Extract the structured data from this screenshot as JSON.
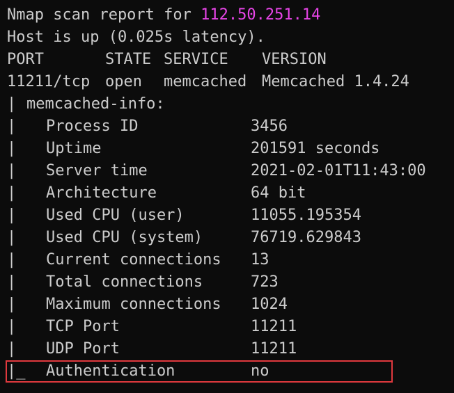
{
  "report": {
    "prefix": "Nmap scan report for ",
    "ip": "112.50.251.14",
    "host_status": "Host is up (0.025s latency).",
    "header": {
      "port": "PORT",
      "state": "STATE",
      "service": "SERVICE",
      "version": "VERSION"
    },
    "service_row": {
      "port": "11211/tcp",
      "state": "open",
      "service": "memcached",
      "version": "Memcached 1.4.24"
    },
    "script_name": "memcached-info:",
    "pipe": "|",
    "last_pipe": "|_",
    "info": [
      {
        "key": "Process ID",
        "value": "3456"
      },
      {
        "key": "Uptime",
        "value": "201591 seconds"
      },
      {
        "key": "Server time",
        "value": "2021-02-01T11:43:00"
      },
      {
        "key": "Architecture",
        "value": "64 bit"
      },
      {
        "key": "Used CPU (user)",
        "value": "11055.195354"
      },
      {
        "key": "Used CPU (system)",
        "value": "76719.629843"
      },
      {
        "key": "Current connections",
        "value": "13"
      },
      {
        "key": "Total connections",
        "value": "723"
      },
      {
        "key": "Maximum connections",
        "value": "1024"
      },
      {
        "key": "TCP Port",
        "value": "11211"
      },
      {
        "key": "UDP Port",
        "value": "11211"
      },
      {
        "key": "Authentication",
        "value": "no"
      }
    ]
  },
  "colors": {
    "background": "#0c0c0c",
    "text": "#cccccc",
    "ip": "#e845e8",
    "highlight_border": "#e0393e"
  }
}
